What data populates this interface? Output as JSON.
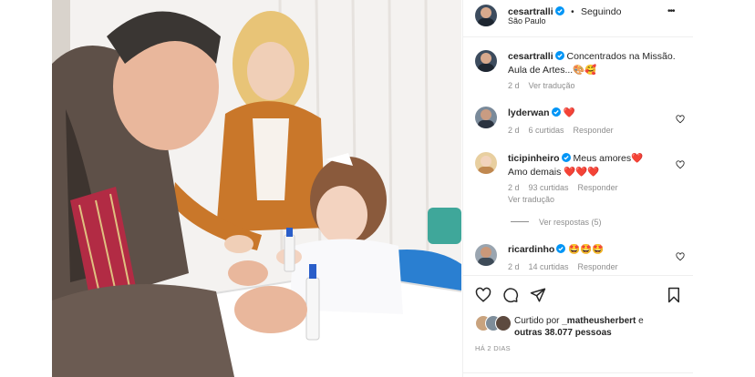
{
  "post": {
    "author": "cesartralli",
    "follow_status": "Seguindo",
    "location": "São Paulo",
    "caption_line1": "Concentrados na Missão.",
    "caption_line2": "Aula de Artes...",
    "caption_emojis": "🎨🥰",
    "caption_time": "2 d",
    "caption_translate": "Ver tradução",
    "more_label": "•••"
  },
  "comments": [
    {
      "user": "lyderwan",
      "text": "❤️",
      "time": "2 d",
      "likes": "6 curtidas",
      "reply": "Responder"
    },
    {
      "user": "ticipinheiro",
      "text": "Meus amores❤️",
      "text2": "Amo demais ❤️❤️❤️",
      "time": "2 d",
      "likes": "93 curtidas",
      "reply": "Responder",
      "translate": "Ver tradução",
      "replies": "Ver respostas (5)"
    },
    {
      "user": "ricardinho",
      "text": "🤩🤩🤩",
      "time": "2 d",
      "likes": "14 curtidas",
      "reply": "Responder"
    }
  ],
  "likes": {
    "prefix": "Curtido por",
    "user": "_matheusherbert",
    "conj": "e",
    "others": "outras 38.077 pessoas"
  },
  "timestamp": "HÁ 2 DIAS",
  "colors": {
    "accent": "#0095f6",
    "heart_red": "#ed4956",
    "border": "#efefef",
    "muted": "#8e8e8e"
  }
}
